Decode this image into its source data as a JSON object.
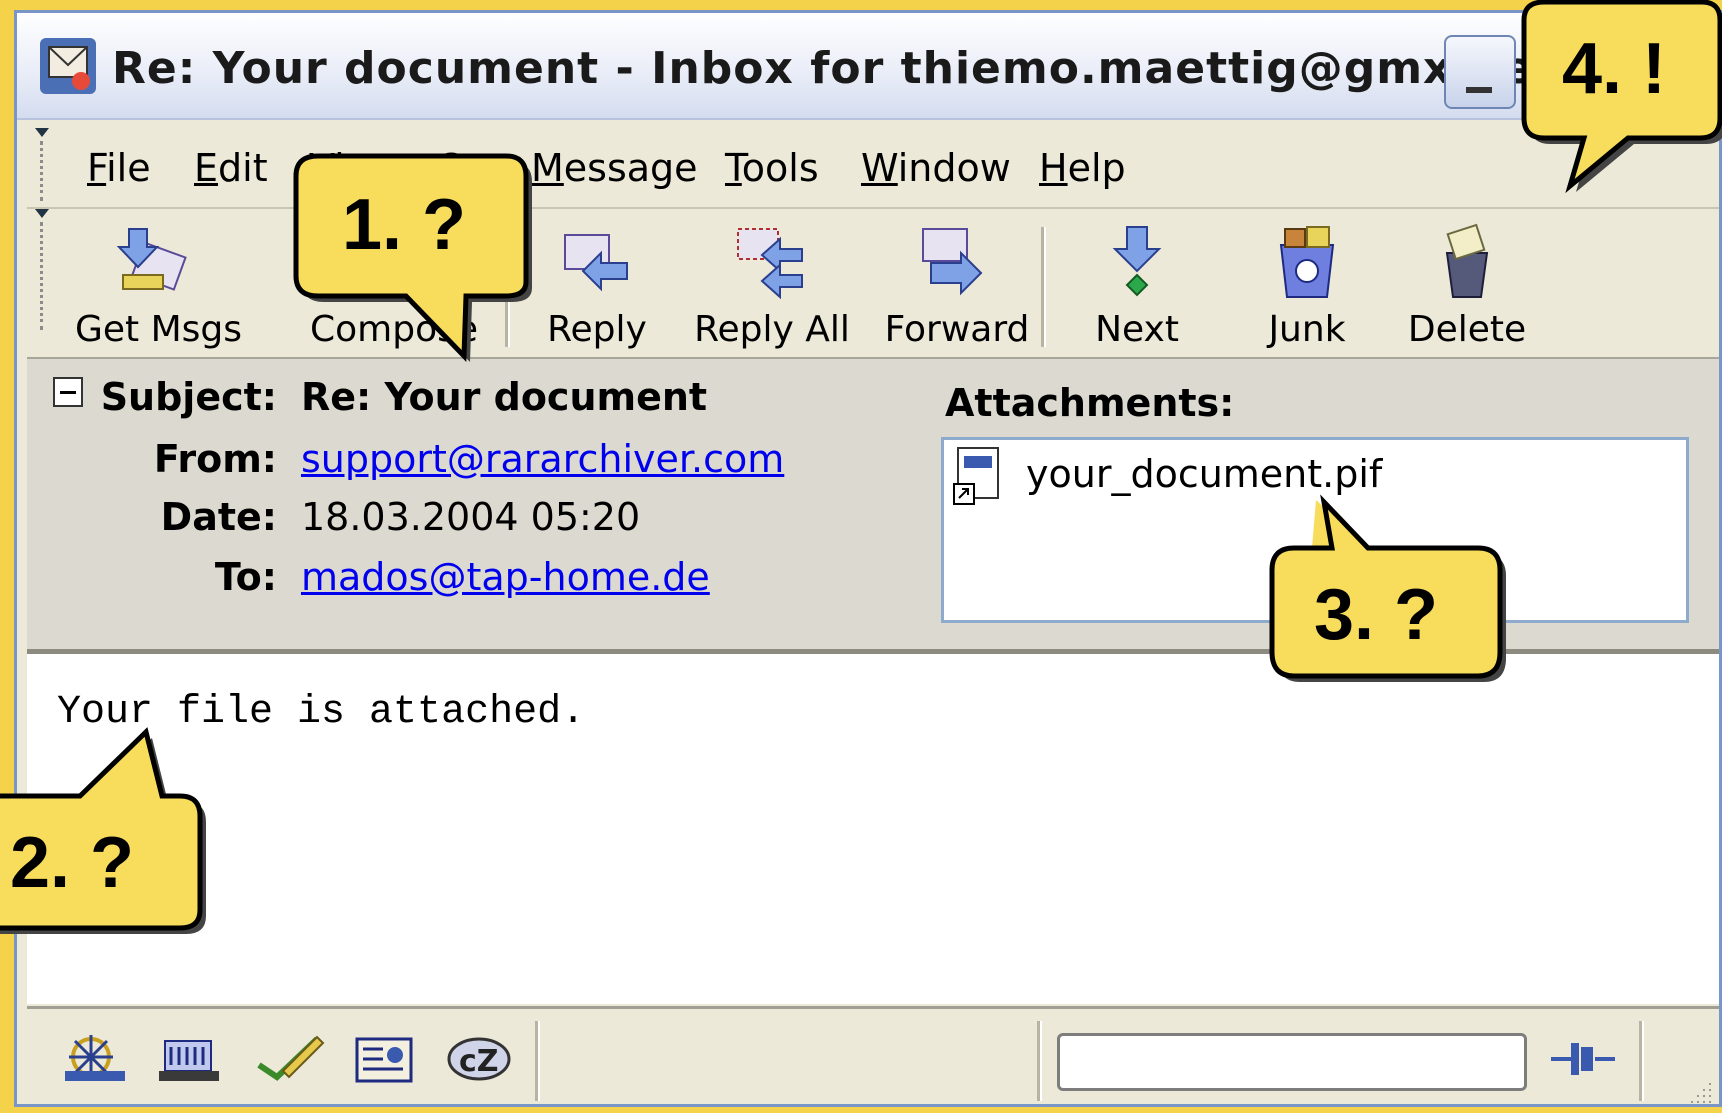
{
  "window": {
    "title": "Re: Your document - Inbox for thiemo.maettig@gmx.de ...",
    "minimize_icon": "minimize-icon"
  },
  "menu": {
    "items": [
      "File",
      "Edit",
      "View",
      "Go",
      "Message",
      "Tools",
      "Window",
      "Help"
    ]
  },
  "toolbar": {
    "get_msgs": "Get Msgs",
    "compose": "Compose",
    "reply": "Reply",
    "reply_all": "Reply All",
    "forward": "Forward",
    "next": "Next",
    "junk": "Junk",
    "delete": "Delete"
  },
  "headers": {
    "subject_label": "Subject:",
    "subject": "Re: Your document",
    "from_label": "From:",
    "from": "support@rararchiver.com",
    "date_label": "Date:",
    "date": "18.03.2004 05:20",
    "to_label": "To:",
    "to": "mados@tap-home.de",
    "attachments_label": "Attachments:",
    "attachment_file": "your_document.pif"
  },
  "message": {
    "body": "Your file is attached."
  },
  "callouts": {
    "c1": "1. ?",
    "c2": "2. ?",
    "c3": "3. ?",
    "c4": "4. !"
  },
  "colors": {
    "callout_fill": "#f8dc5c",
    "link": "#0000ee",
    "background": "#f4d34a"
  }
}
